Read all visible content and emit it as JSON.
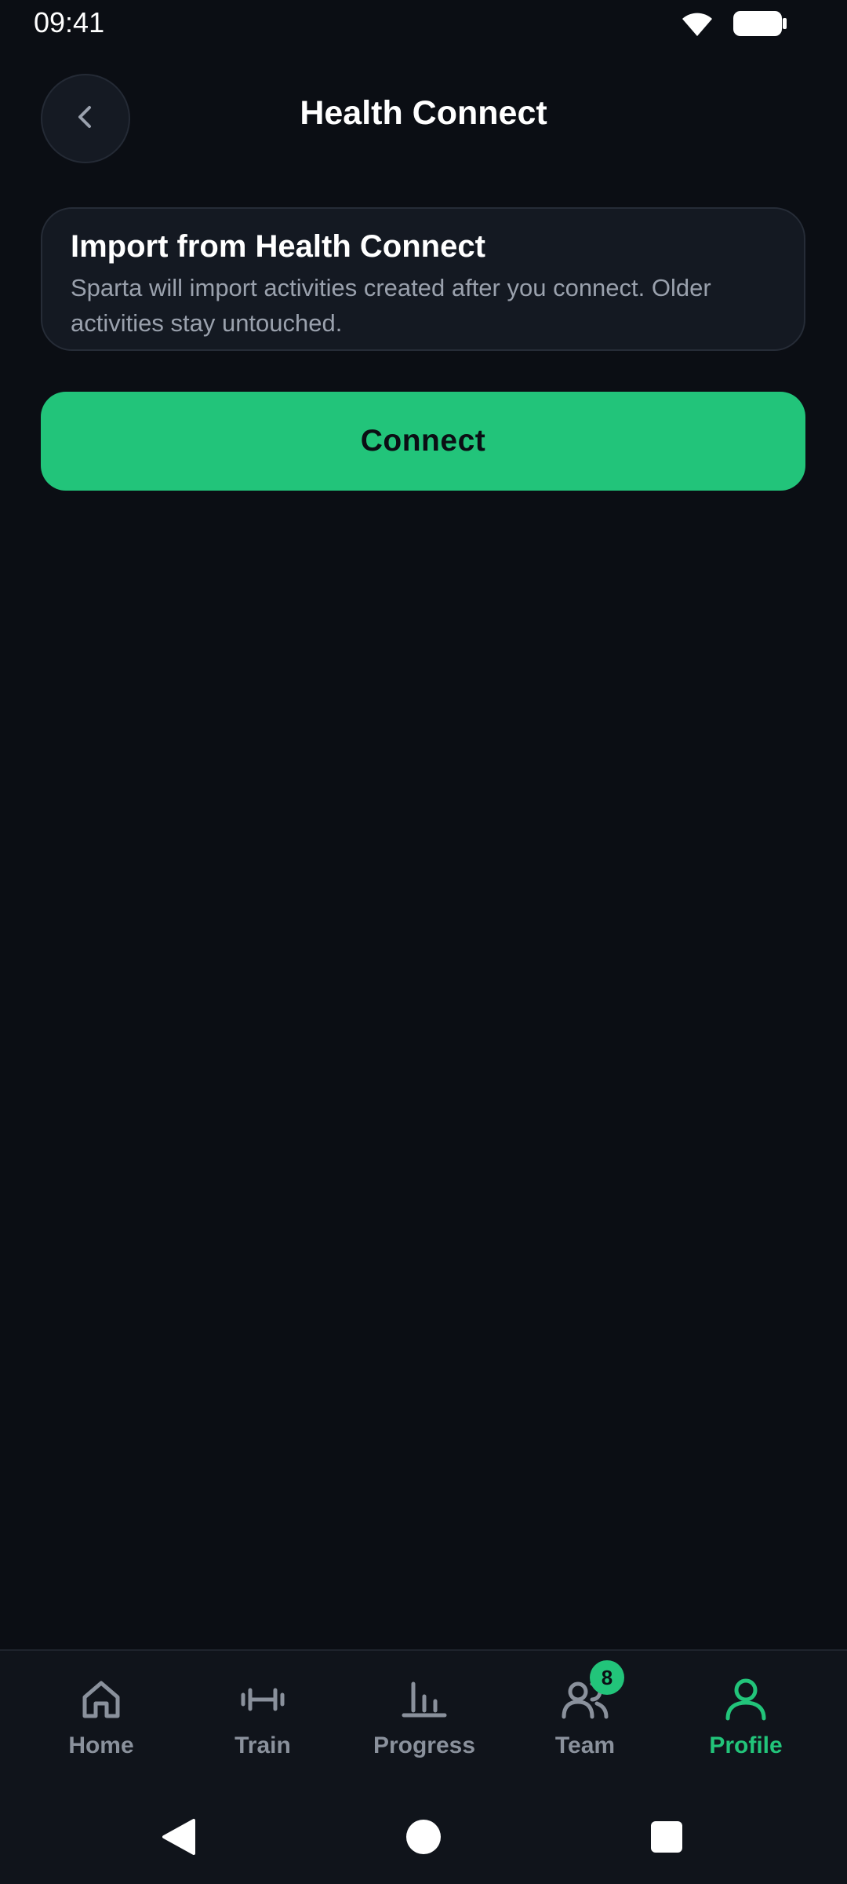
{
  "status_bar": {
    "time": "09:41",
    "icons": [
      "wifi-icon",
      "battery-icon"
    ]
  },
  "header": {
    "title": "Health Connect",
    "back_icon": "chevron-left-icon"
  },
  "info_card": {
    "title": "Import from Health Connect",
    "body": "Sparta will import activities created after you connect. Older activities stay untouched."
  },
  "connect_button": {
    "label": "Connect"
  },
  "bottom_nav": {
    "items": [
      {
        "label": "Home",
        "icon": "home-icon",
        "active": false
      },
      {
        "label": "Train",
        "icon": "dumbbell-icon",
        "active": false
      },
      {
        "label": "Progress",
        "icon": "bar-chart-icon",
        "active": false
      },
      {
        "label": "Team",
        "icon": "users-icon",
        "active": false,
        "badge": "8"
      },
      {
        "label": "Profile",
        "icon": "user-icon",
        "active": true
      }
    ]
  },
  "system_nav": {
    "icons": [
      "back-triangle-icon",
      "home-circle-icon",
      "recents-square-icon"
    ]
  },
  "colors": {
    "background": "#0b0e14",
    "accent": "#22c47a",
    "inactive": "#8a919c",
    "card": "#141922"
  }
}
